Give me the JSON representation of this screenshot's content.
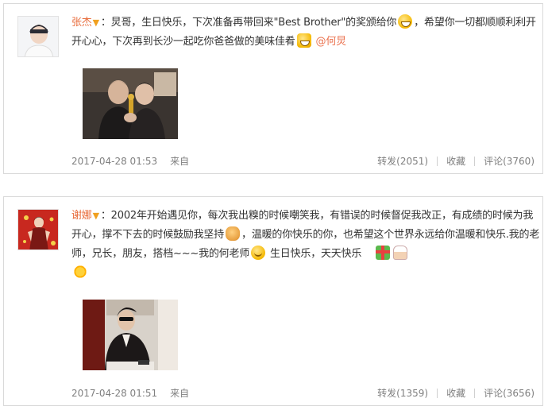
{
  "posts": [
    {
      "author": "张杰",
      "text_a": "：炅哥，生日快乐，下次准备再带回来\"Best Brother\"的奖颁给你",
      "text_b": "，希望你一切都顺顺利利开开心心，下次再到长沙一起吃你爸爸做的美味佳肴",
      "mention": "@何炅",
      "time": "2017-04-28 01:53",
      "source": "来自",
      "repost": "转发(2051)",
      "favorite": "收藏",
      "comment": "评论(3760)"
    },
    {
      "author": "谢娜",
      "text_a": "：2002年开始遇见你，每次我出糗的时候嘲笑我，有错误的时候督促我改正，有成绩的时候为我开心，撑不下去的时候鼓励我坚持",
      "text_b": "，温暖的你快乐的你，也希望这个世界永远给你温暖和快乐.我的老师，兄长，朋友，搭档~~~我的何老师",
      "text_c": " 生日快乐，天天快乐 ",
      "time": "2017-04-28 01:51",
      "source": "来自",
      "repost": "转发(1359)",
      "favorite": "收藏",
      "comment": "评论(3656)"
    }
  ],
  "colors": {
    "username": "#e86b3a",
    "mention": "#eb7350",
    "meta": "#808080",
    "border": "#d9d9d9"
  }
}
